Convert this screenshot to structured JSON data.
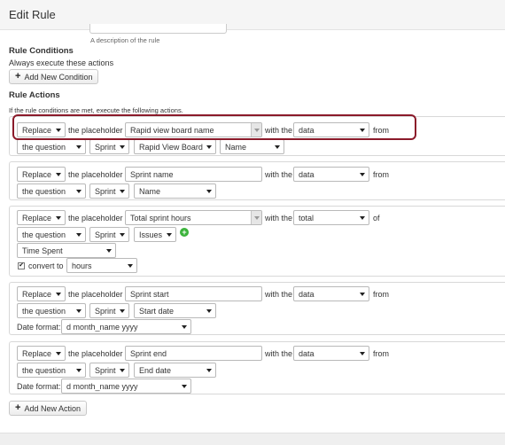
{
  "header": {
    "title": "Edit Rule"
  },
  "description": {
    "help": "A description of the rule"
  },
  "conditions": {
    "heading": "Rule Conditions",
    "subtitle": "Always execute these actions",
    "add_label": "Add New Condition"
  },
  "actions": {
    "heading": "Rule Actions",
    "subtitle": "If the rule conditions are met, execute the following actions.",
    "add_label": "Add New Action",
    "common": {
      "replace": "Replace",
      "the_placeholder": "the placeholder",
      "with_the": "with the",
      "from": "from",
      "of": "of",
      "the_question": "the question",
      "sprint": "Sprint",
      "date_format_label": "Date format:",
      "convert_to": "convert to"
    },
    "items": [
      {
        "placeholder": "Rapid view board name",
        "with": "data",
        "sub1": "Rapid View Board",
        "sub2": "Name"
      },
      {
        "placeholder": "Sprint name",
        "with": "data",
        "field": "Name"
      },
      {
        "placeholder": "Total sprint hours",
        "with": "total",
        "field": "Issues",
        "metric": "Time Spent",
        "convert_unit": "hours",
        "convert_checked": true
      },
      {
        "placeholder": "Sprint start",
        "with": "data",
        "field": "Start date",
        "date_format": "d month_name yyyy"
      },
      {
        "placeholder": "Sprint end",
        "with": "data",
        "field": "End date",
        "date_format": "d month_name yyyy"
      }
    ]
  },
  "icons": {
    "plus": "+",
    "check": "✔"
  },
  "colors": {
    "highlight": "#8b1a2a",
    "add_icon": "#3bb33b"
  }
}
